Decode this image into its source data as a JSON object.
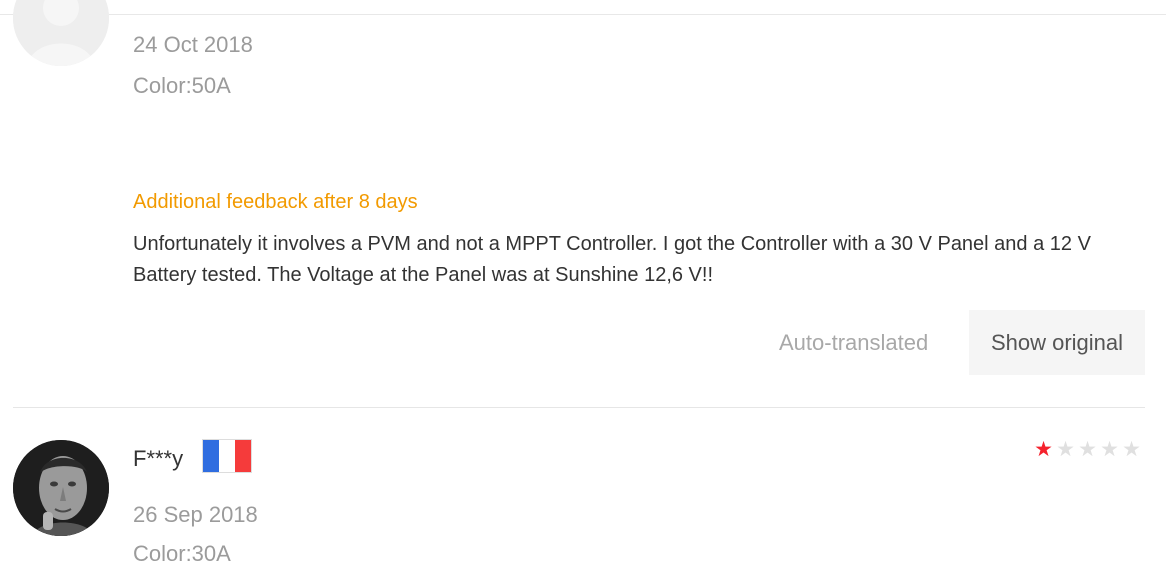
{
  "review1": {
    "date": "24 Oct 2018",
    "color": "Color:50A",
    "additional_feedback_title": "Additional feedback after 8 days",
    "additional_feedback_text": "Unfortunately it involves a PVM and not a MPPT Controller. I got the Controller with a 30 V Panel and a 12 V Battery tested. The Voltage at the Panel was at Sunshine 12,6 V!!",
    "auto_translated_label": "Auto-translated",
    "show_original_label": "Show original"
  },
  "review2": {
    "reviewer_name": "F***y",
    "country_flag_icon": "france-flag-icon",
    "rating": 1,
    "max_rating": 5,
    "date": "26 Sep 2018",
    "color": "Color:30A"
  },
  "colors": {
    "feedback_accent": "#f29a00",
    "star_filled": "#f5222d",
    "star_empty": "#e0e0e0",
    "flag_blue": "#2f6de0",
    "flag_white": "#ffffff",
    "flag_red": "#f53b3b"
  }
}
